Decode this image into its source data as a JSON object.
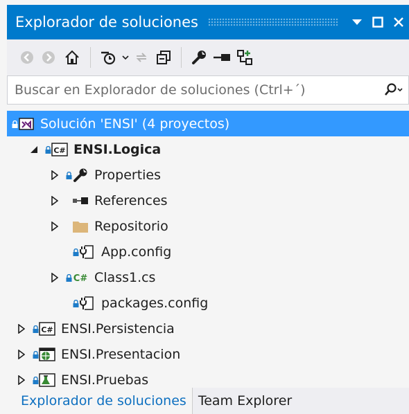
{
  "window": {
    "title": "Explorador de soluciones",
    "accent_color": "#007acc",
    "selection_color": "#3399ff"
  },
  "toolbar": {
    "buttons": [
      "back-icon",
      "forward-icon",
      "home-icon",
      "pending-changes-filter-icon",
      "sync-icon",
      "collapse-all-icon",
      "properties-icon",
      "preview-icon",
      "show-all-files-icon"
    ]
  },
  "search": {
    "placeholder": "Buscar en Explorador de soluciones (Ctrl+´)"
  },
  "tree": {
    "solution": "Solución 'ENSI'  (4 proyectos)",
    "logica": "ENSI.Logica",
    "properties": "Properties",
    "references": "References",
    "repositorio": "Repositorio",
    "app_config": "App.config",
    "class1": "Class1.cs",
    "packages_config": "packages.config",
    "persistencia": "ENSI.Persistencia",
    "presentacion": "ENSI.Presentacion",
    "pruebas": "ENSI.Pruebas"
  },
  "tabs": {
    "solution_explorer": "Explorador de soluciones",
    "team_explorer": "Team Explorer"
  }
}
